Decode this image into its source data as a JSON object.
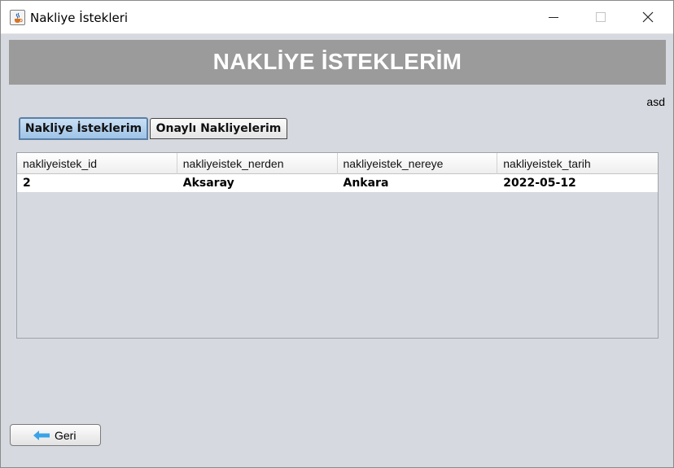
{
  "window": {
    "title": "Nakliye İstekleri",
    "app_icon": "java-cup-icon",
    "controls": [
      "minimize-icon",
      "maximize-icon",
      "close-icon"
    ]
  },
  "header": {
    "title": "NAKLİYE İSTEKLERİM",
    "background_color": "#9b9b9b",
    "text_color": "#ffffff"
  },
  "user": {
    "name": "asd"
  },
  "tabs": [
    {
      "label": "Nakliye İsteklerim",
      "selected": true
    },
    {
      "label": "Onaylı Nakliyelerim",
      "selected": false
    }
  ],
  "table": {
    "columns": [
      "nakliyeistek_id",
      "nakliyeistek_nerden",
      "nakliyeistek_nereye",
      "nakliyeistek_tarih"
    ],
    "rows": [
      [
        "2",
        "Aksaray",
        "Ankara",
        "2022-05-12"
      ]
    ]
  },
  "back_button": {
    "label": "Geri",
    "icon": "arrow-left-icon",
    "icon_color": "#3aa3e8"
  }
}
